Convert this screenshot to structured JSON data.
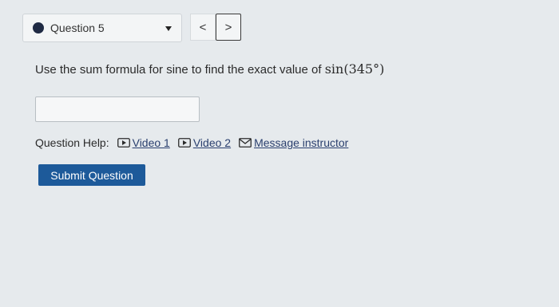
{
  "question_nav": {
    "selected": "Question 5",
    "prev_label": "<",
    "next_label": ">"
  },
  "prompt": {
    "text": "Use the sum formula for sine to find the exact value of ",
    "math": "sin(345°)"
  },
  "answer": {
    "value": ""
  },
  "help": {
    "label": "Question Help:",
    "links": [
      "Video 1",
      "Video 2",
      "Message instructor"
    ]
  },
  "submit_label": "Submit Question",
  "icons": [
    "dropdown-arrow-icon",
    "video-icon",
    "mail-icon"
  ]
}
